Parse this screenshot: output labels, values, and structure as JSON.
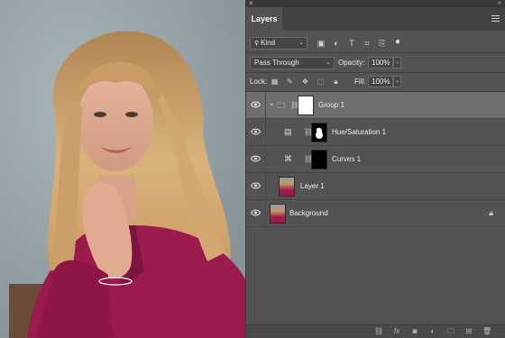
{
  "panel": {
    "tab_label": "Layers",
    "filter_kind": "Kind",
    "blend_mode": "Pass Through",
    "opacity_label": "Opacity:",
    "opacity_value": "100%",
    "lock_label": "Lock:",
    "fill_label": "Fill:",
    "fill_value": "100%"
  },
  "layers": [
    {
      "name": "Group 1",
      "selected": true,
      "type": "group"
    },
    {
      "name": "Hue/Saturation 1",
      "selected": false,
      "type": "adjustment"
    },
    {
      "name": "Curves 1",
      "selected": false,
      "type": "adjustment"
    },
    {
      "name": "Layer 1",
      "selected": false,
      "type": "pixel"
    },
    {
      "name": "Background",
      "selected": false,
      "type": "background",
      "locked": true
    }
  ],
  "icons": {
    "close": "close-icon",
    "collapse": "collapse-icon",
    "menu": "panel-menu-icon",
    "eye": "eye-icon",
    "lock": "lock-icon"
  },
  "colors": {
    "panel_bg": "#535353",
    "selected_row": "#6e6e6e",
    "shirt": "#9b1b4e"
  }
}
